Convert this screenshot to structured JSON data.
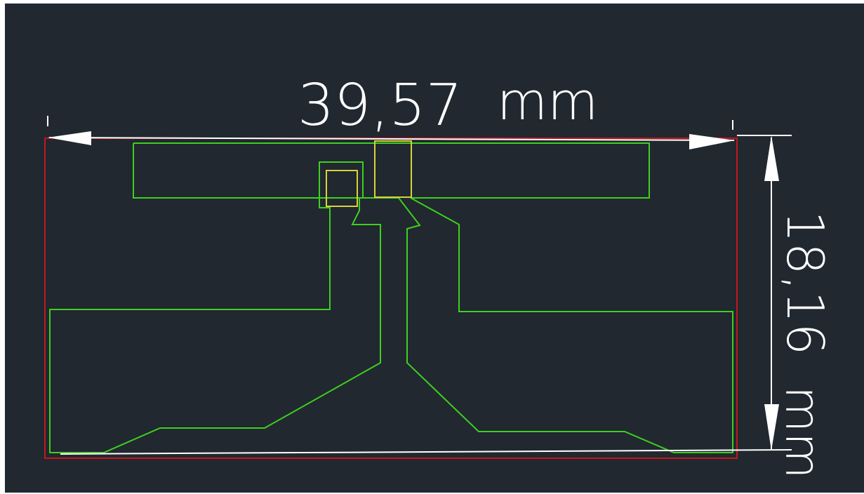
{
  "drawing": {
    "width_dimension": {
      "value": "39,57",
      "unit": "mm"
    },
    "height_dimension": {
      "value": "18,16",
      "unit": "mm"
    }
  },
  "colors": {
    "canvas_background": "#212830",
    "board_outline": "#c4161c",
    "copper_trace": "#3ecf1f",
    "pad": "#d8d23a",
    "dimension_line": "#ffffff"
  }
}
